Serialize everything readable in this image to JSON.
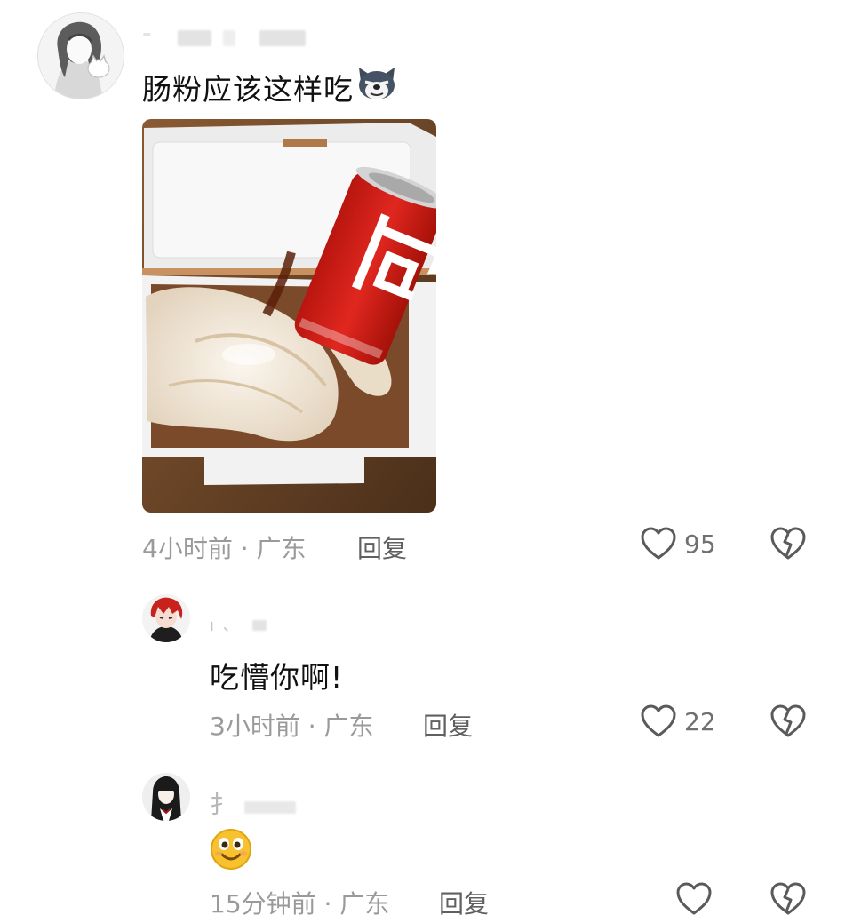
{
  "comments": [
    {
      "text": "肠粉应该这样吃",
      "emoji": "husky-emoji",
      "meta": "4小时前 · 广东",
      "reply_label": "回复",
      "like_count": "95",
      "has_image": true
    },
    {
      "text": "吃懵你啊!",
      "meta": "3小时前 · 广东",
      "reply_label": "回复",
      "like_count": "22"
    },
    {
      "emoji": "smile-emoji",
      "meta": "15分钟前 · 广东",
      "reply_label": "回复",
      "like_count": ""
    }
  ],
  "colors": {
    "text": "#111111",
    "meta": "#9a9a9a",
    "icon": "#5a5a5a",
    "can_red": "#d9231d"
  }
}
